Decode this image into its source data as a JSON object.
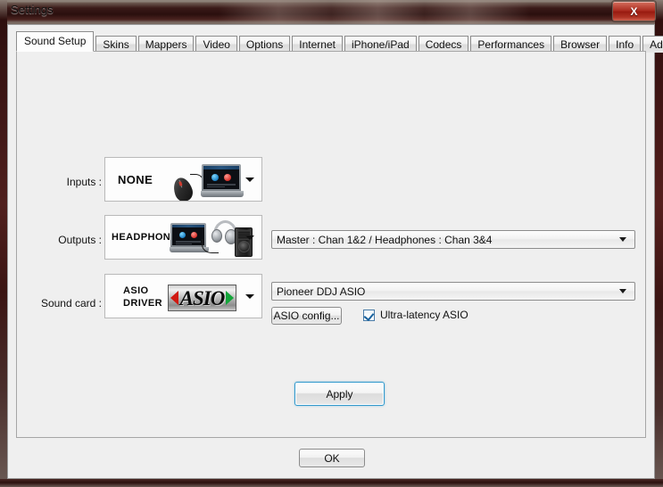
{
  "window": {
    "title": "Settings",
    "close_label": "X"
  },
  "tabs": [
    {
      "label": "Sound Setup",
      "selected": true
    },
    {
      "label": "Skins",
      "selected": false
    },
    {
      "label": "Mappers",
      "selected": false
    },
    {
      "label": "Video",
      "selected": false
    },
    {
      "label": "Options",
      "selected": false
    },
    {
      "label": "Internet",
      "selected": false
    },
    {
      "label": "iPhone/iPad",
      "selected": false
    },
    {
      "label": "Codecs",
      "selected": false
    },
    {
      "label": "Performances",
      "selected": false
    },
    {
      "label": "Browser",
      "selected": false
    },
    {
      "label": "Info",
      "selected": false
    },
    {
      "label": "Advanced Options",
      "selected": false
    }
  ],
  "sound_setup": {
    "inputs": {
      "label": "Inputs :",
      "value": "NONE"
    },
    "outputs": {
      "label": "Outputs :",
      "value": "HEADPHONES",
      "channel_mapping": "Master : Chan 1&2 / Headphones : Chan 3&4"
    },
    "sound_card": {
      "label": "Sound card :",
      "value_line1": "ASIO",
      "value_line2": "DRIVER",
      "logo_text": "ASIO",
      "driver": "Pioneer DDJ ASIO",
      "config_button": "ASIO config...",
      "ultra_latency_label": "Ultra-latency ASIO",
      "ultra_latency_checked": true
    },
    "apply_button": "Apply"
  },
  "footer": {
    "ok_button": "OK"
  },
  "colors": {
    "accent": "#3399cc",
    "panel": "#efefef",
    "close_red": "#a8281c"
  }
}
